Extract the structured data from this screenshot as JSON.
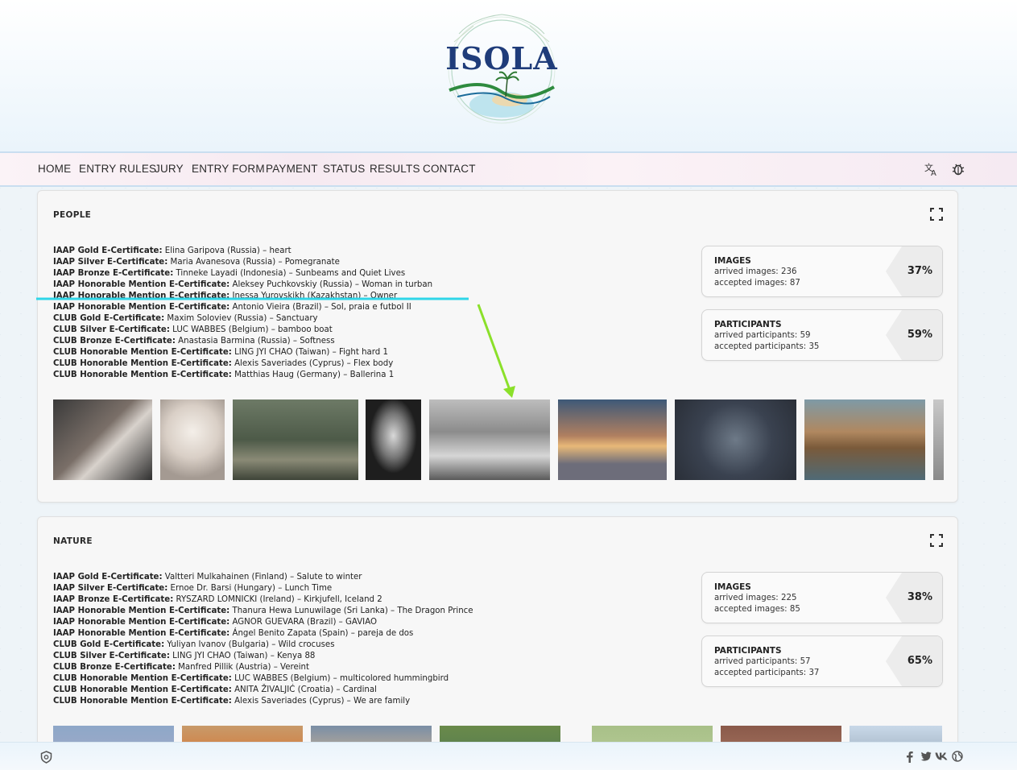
{
  "site": {
    "logo_text": "ISOLA"
  },
  "nav": {
    "items": [
      "HOME",
      "ENTRY RULES",
      "JURY",
      "ENTRY FORM",
      "PAYMENT",
      "STATUS",
      "RESULTS",
      "CONTACT"
    ],
    "translate_icon": "translate-icon",
    "settings_icon": "bug-icon"
  },
  "sections": [
    {
      "title": "PEOPLE",
      "awards": [
        {
          "award": "IAAP Gold E-Certificate:",
          "text": " Elina Garipova (Russia) – heart"
        },
        {
          "award": "IAAP Silver E-Certificate:",
          "text": " Maria Avanesova (Russia) – Pomegranate"
        },
        {
          "award": "IAAP Bronze E-Certificate:",
          "text": " Tinneke Layadi (Indonesia) – Sunbeams and Quiet Lives"
        },
        {
          "award": "IAAP Honorable Mention E-Certificate:",
          "text": " Aleksey Puchkovskiy (Russia) – Woman in turban"
        },
        {
          "award": "IAAP Honorable Mention E-Certificate:",
          "text": " Inessa Yurovskikh (Kazakhstan) – Owner"
        },
        {
          "award": "IAAP Honorable Mention E-Certificate:",
          "text": " Antonio Vieira (Brazil) – Sol, praia e futbol II"
        },
        {
          "award": "CLUB Gold E-Certificate:",
          "text": " Maxim Soloviev (Russia) – Sanctuary"
        },
        {
          "award": "CLUB Silver E-Certificate:",
          "text": " LUC WABBES (Belgium) – bamboo boat"
        },
        {
          "award": "CLUB Bronze E-Certificate:",
          "text": " Anastasia Barmina (Russia) – Softness"
        },
        {
          "award": "CLUB Honorable Mention E-Certificate:",
          "text": " LING JYI CHAO (Taiwan) – Fight hard 1"
        },
        {
          "award": "CLUB Honorable Mention E-Certificate:",
          "text": " Alexis Saveriades (Cyprus) – Flex body"
        },
        {
          "award": "CLUB Honorable Mention E-Certificate:",
          "text": " Matthias Haug (Germany) – Ballerina 1"
        }
      ],
      "images": {
        "title": "IMAGES",
        "arrived": "arrived images: 236",
        "accepted": "accepted images: 87",
        "percent": "37%"
      },
      "participants": {
        "title": "PARTICIPANTS",
        "arrived": "arrived participants: 59",
        "accepted": "accepted participants: 35",
        "percent": "59%"
      }
    },
    {
      "title": "NATURE",
      "awards": [
        {
          "award": "IAAP Gold E-Certificate:",
          "text": " Valtteri Mulkahainen (Finland) – Salute to winter"
        },
        {
          "award": "IAAP Silver E-Certificate:",
          "text": " Ernoe Dr. Barsi (Hungary) – Lunch Time"
        },
        {
          "award": "IAAP Bronze E-Certificate:",
          "text": " RYSZARD LOMNICKI (Ireland) – Kirkjufell, Iceland 2"
        },
        {
          "award": "IAAP Honorable Mention E-Certificate:",
          "text": " Thanura Hewa Lunuwilage (Sri Lanka) – The Dragon Prince"
        },
        {
          "award": "IAAP Honorable Mention E-Certificate:",
          "text": " AGNOR GUEVARA (Brazil) – GAVIAO"
        },
        {
          "award": "IAAP Honorable Mention E-Certificate:",
          "text": " Ángel Benito Zapata (Spain) – pareja de dos"
        },
        {
          "award": "CLUB Gold E-Certificate:",
          "text": " Yuliyan Ivanov (Bulgaria) – Wild crocuses"
        },
        {
          "award": "CLUB Silver E-Certificate:",
          "text": " LING JYI CHAO (Taiwan) – Kenya 88"
        },
        {
          "award": "CLUB Bronze E-Certificate:",
          "text": " Manfred Pillik (Austria) – Vereint"
        },
        {
          "award": "CLUB Honorable Mention E-Certificate:",
          "text": " LUC WABBES (Belgium) – multicolored hummingbird"
        },
        {
          "award": "CLUB Honorable Mention E-Certificate:",
          "text": " ANITA ŽIVALJIĆ (Croatia) – Cardinal"
        },
        {
          "award": "CLUB Honorable Mention E-Certificate:",
          "text": " Alexis Saveriades (Cyprus) – We are family"
        }
      ],
      "images": {
        "title": "IMAGES",
        "arrived": "arrived images: 225",
        "accepted": "accepted images: 85",
        "percent": "38%"
      },
      "participants": {
        "title": "PARTICIPANTS",
        "arrived": "arrived participants: 57",
        "accepted": "accepted participants: 37",
        "percent": "65%"
      }
    }
  ],
  "footer": {
    "left_icon": "shield-icon",
    "social_icons": [
      "facebook-icon",
      "twitter-icon",
      "vk-icon",
      "globe-icon"
    ]
  },
  "colors": {
    "logo_navy": "#1f3c7a",
    "annotation_cyan": "#2fd6e8",
    "annotation_green": "#8be02a"
  }
}
